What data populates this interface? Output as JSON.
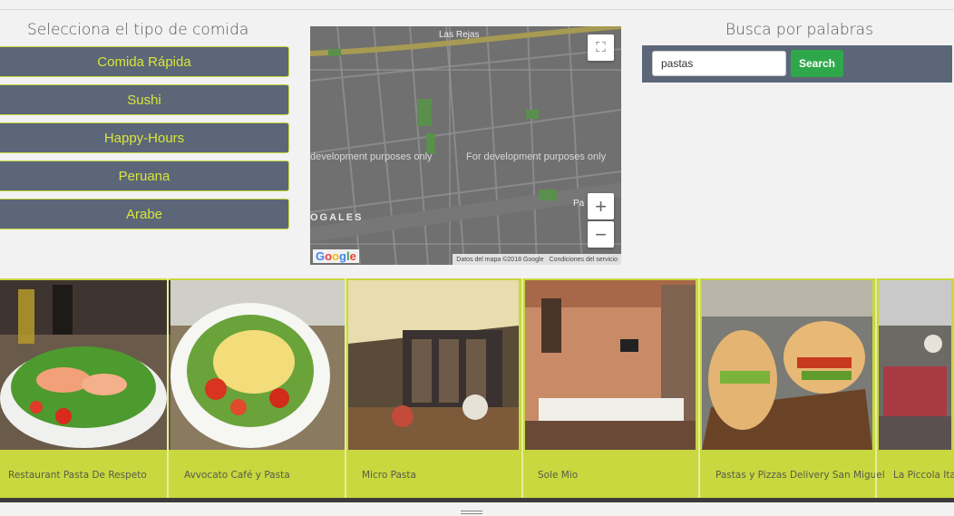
{
  "categories": {
    "title": "Selecciona el tipo de comida",
    "items": [
      "Comida Rápida",
      "Sushi",
      "Happy-Hours",
      "Peruana",
      "Arabe"
    ]
  },
  "map": {
    "dev_text_left": "development purposes only",
    "dev_text_right": "For development purposes only",
    "footer_data": "Datos del mapa ©2018 Google",
    "footer_terms": "Condiciones del servicio",
    "logo": "Google",
    "label_top": "Las Rejas",
    "label_left": "OGALES",
    "label_right": "Pa"
  },
  "search": {
    "title": "Busca por palabras",
    "value": "pastas",
    "button_label": "Search"
  },
  "restaurants": [
    {
      "name": "Restaurant Pasta De Respeto"
    },
    {
      "name": "Avvocato Café y Pasta"
    },
    {
      "name": "Micro Pasta"
    },
    {
      "name": "Sole Mio"
    },
    {
      "name": "Pastas y Pizzas Delivery San Miguel"
    },
    {
      "name": "La Piccola Ita"
    }
  ],
  "colors": {
    "accent": "#c8d83e",
    "panel": "#5b6778",
    "button_text": "#d9e43b",
    "search_button": "#2ea84a"
  }
}
